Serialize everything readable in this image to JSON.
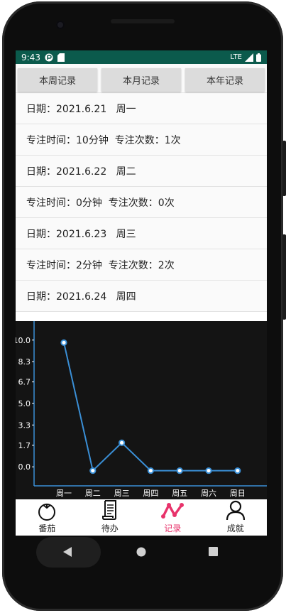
{
  "status_bar": {
    "time": "9:43",
    "network": "LTE"
  },
  "tabs": [
    {
      "label": "本周记录"
    },
    {
      "label": "本月记录"
    },
    {
      "label": "本年记录"
    }
  ],
  "records": [
    {
      "text": "日期：2021.6.21   周一"
    },
    {
      "text": "专注时间：10分钟  专注次数：1次"
    },
    {
      "text": "日期：2021.6.22   周二"
    },
    {
      "text": "专注时间：0分钟  专注次数：0次"
    },
    {
      "text": "日期：2021.6.23   周三"
    },
    {
      "text": "专注时间：2分钟  专注次数：2次"
    },
    {
      "text": "日期：2021.6.24   周四"
    }
  ],
  "chart_data": {
    "type": "line",
    "categories": [
      "周一",
      "周二",
      "周三",
      "周四",
      "周五",
      "周六",
      "周日"
    ],
    "values": [
      9.8,
      -0.3,
      1.9,
      -0.3,
      -0.3,
      -0.3,
      -0.3
    ],
    "y_ticks": [
      "10.0",
      "8.3",
      "6.7",
      "5.0",
      "3.3",
      "1.7",
      "0.0"
    ],
    "ylim": [
      -1.5,
      11.5
    ],
    "line_color": "#3a8fd6",
    "grid": false
  },
  "bottom_nav": [
    {
      "label": "番茄",
      "icon": "tomato-icon"
    },
    {
      "label": "待办",
      "icon": "scroll-icon"
    },
    {
      "label": "记录",
      "icon": "trend-icon",
      "active": true
    },
    {
      "label": "成就",
      "icon": "person-icon"
    }
  ],
  "colors": {
    "status_bar": "#0b5a4c",
    "active_nav": "#e8336b",
    "chart_bg": "#141414"
  }
}
